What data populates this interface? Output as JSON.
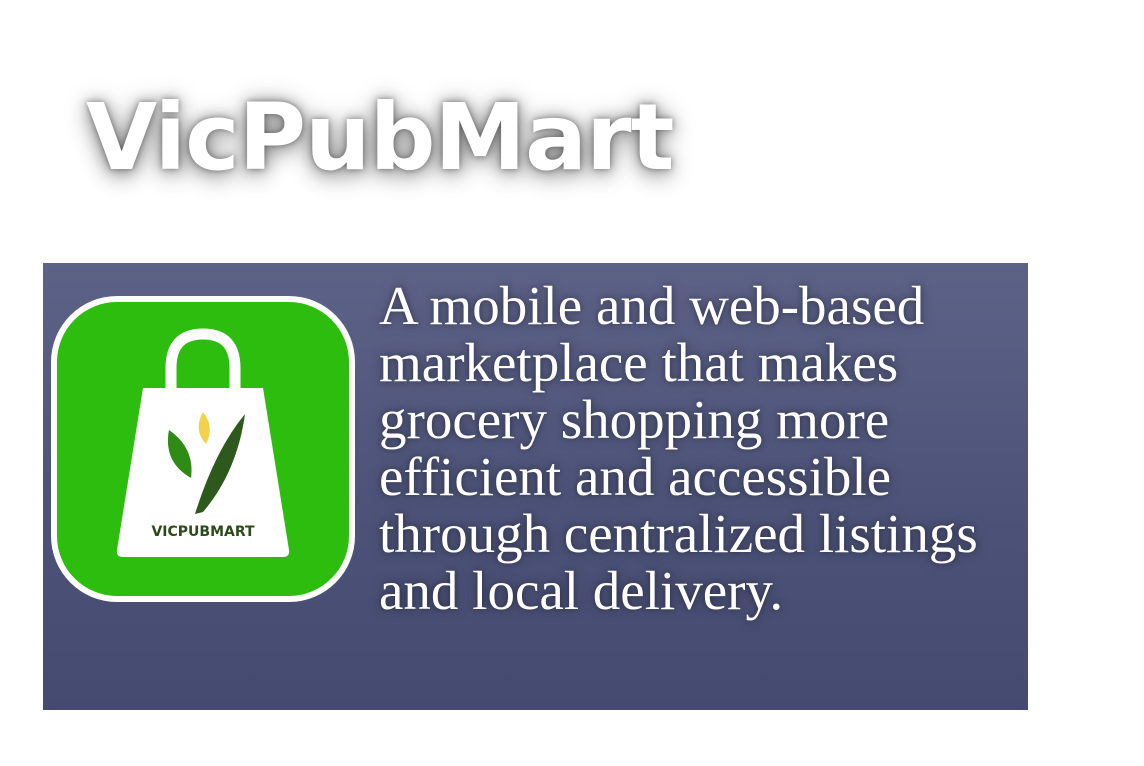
{
  "title": "VicPubMart",
  "logo": {
    "brand_text": "VICPUBMART",
    "icon": "shopping-bag-icon",
    "colors": {
      "background": "#2cbd0f",
      "bag": "#ffffff",
      "leaf_green": "#2f8a16",
      "leaf_dark": "#2d5a1c",
      "leaf_yellow": "#f2d24a"
    }
  },
  "description": "A mobile and web-based marketplace that makes grocery shopping more efficient and accessible through centralized listings and local delivery.",
  "colors": {
    "panel": "#545a7f",
    "text": "#ffffff"
  }
}
